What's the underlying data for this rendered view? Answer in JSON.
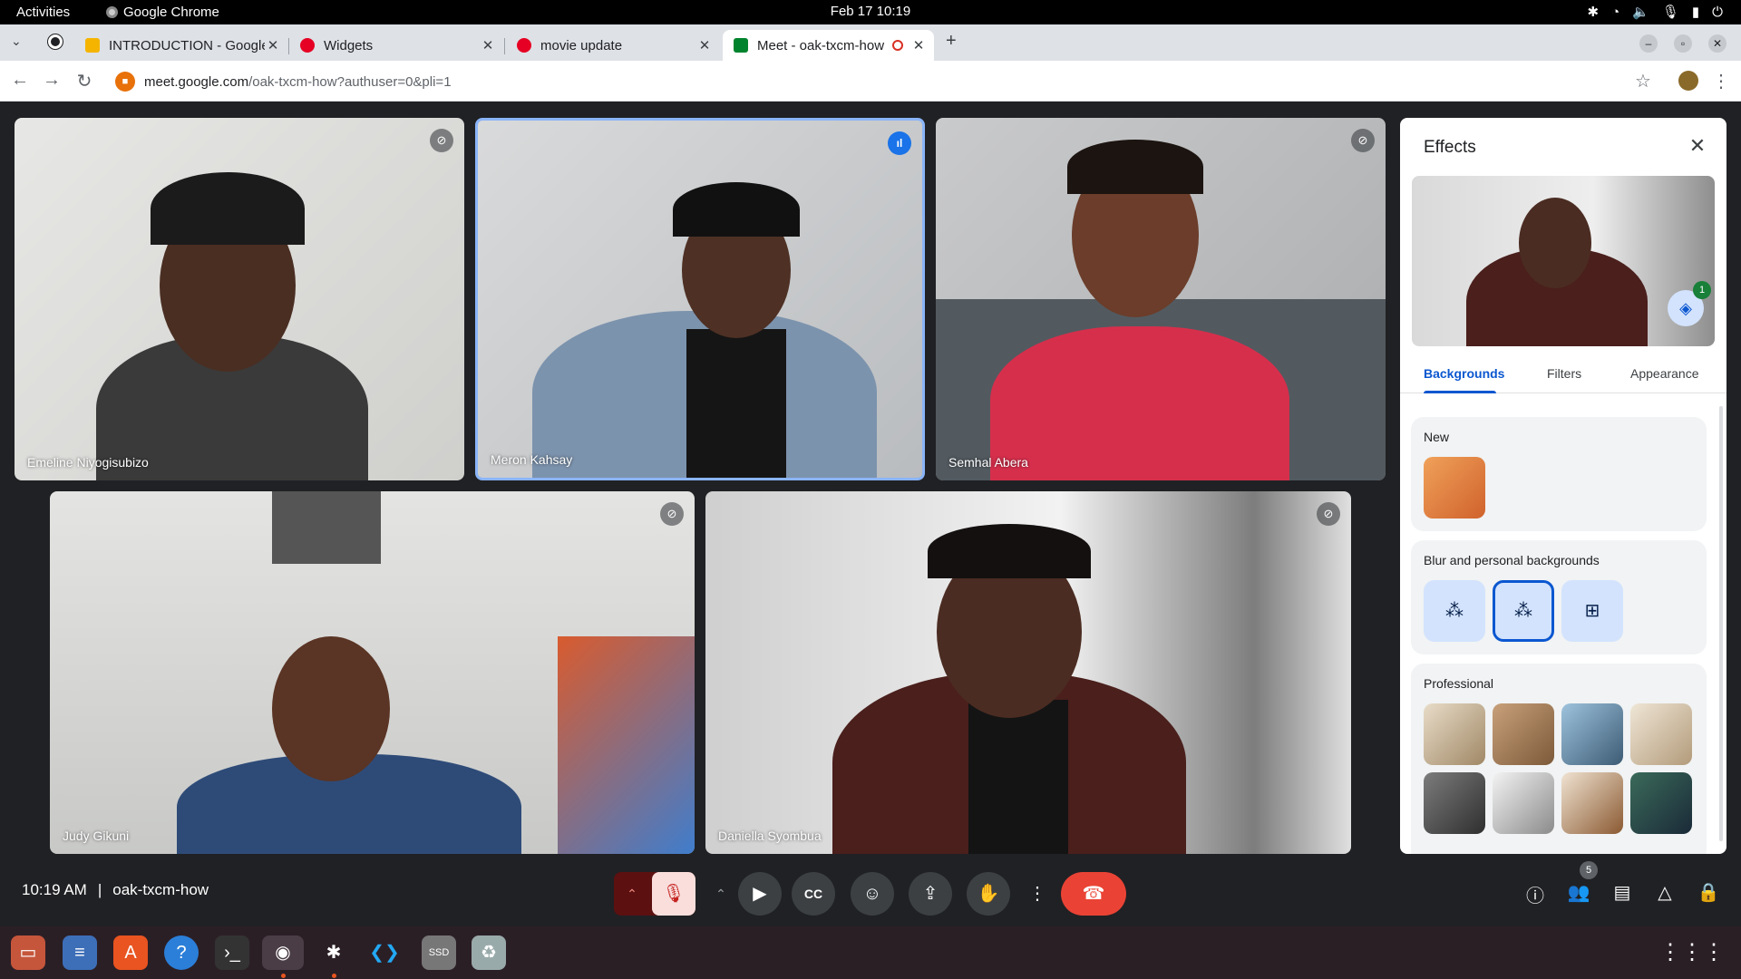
{
  "system": {
    "activities": "Activities",
    "app_name": "Google Chrome",
    "clock": "Feb 17  10:19"
  },
  "tabs": [
    {
      "title": "INTRODUCTION - Google",
      "fav_color": "#f4b400"
    },
    {
      "title": "Widgets",
      "fav_color": "#e60023"
    },
    {
      "title": "movie update",
      "fav_color": "#e60023"
    },
    {
      "title": "Meet - oak-txcm-how",
      "fav_color": "#00832d",
      "active": true
    }
  ],
  "address": {
    "host": "meet.google.com",
    "path": "/oak-txcm-how?authuser=0&pli=1"
  },
  "participants": [
    {
      "name": "Emeline Niyogisubizo",
      "muted": true
    },
    {
      "name": "Meron Kahsay",
      "speaking": true
    },
    {
      "name": "Semhal Abera",
      "muted": true
    },
    {
      "name": "Judy Gikuni",
      "muted": true
    },
    {
      "name": "Daniella Syombua",
      "muted": true
    }
  ],
  "effects": {
    "title": "Effects",
    "layers_badge": "1",
    "tabs": [
      "Backgrounds",
      "Filters",
      "Appearance"
    ],
    "active_tab": "Backgrounds",
    "sections": {
      "new": "New",
      "blur": "Blur and personal backgrounds",
      "professional": "Professional"
    }
  },
  "controls": {
    "time": "10:19 AM",
    "separator": "|",
    "meeting_code": "oak-txcm-how",
    "people_count": "5"
  },
  "colors": {
    "accent": "#0b57d0",
    "end_call": "#ea4335",
    "speaking_border": "#8ab4f8"
  }
}
